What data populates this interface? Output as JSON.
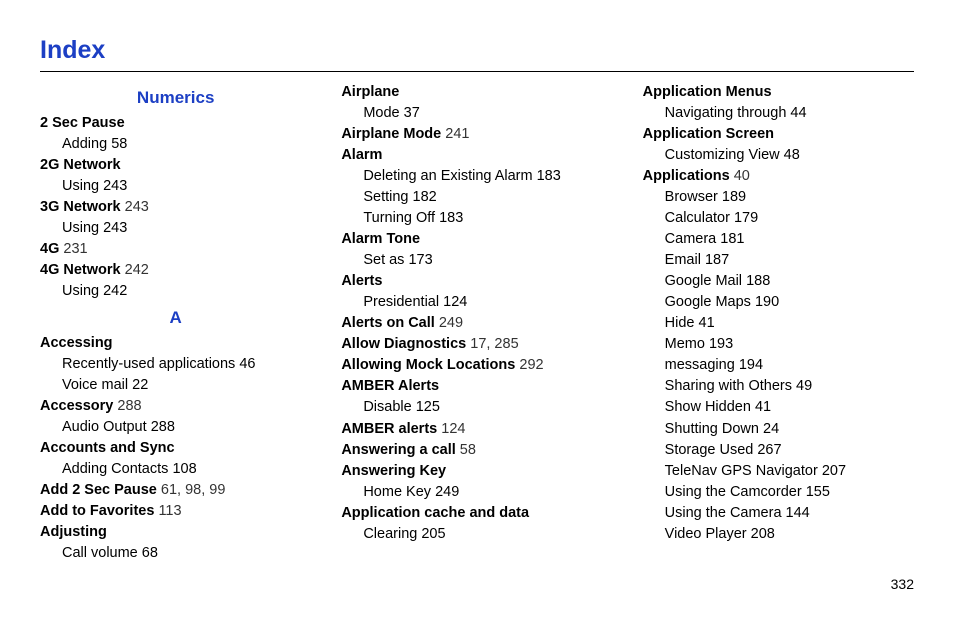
{
  "page_title": "Index",
  "page_number": "332",
  "columns": [
    {
      "sections": [
        {
          "heading": "Numerics",
          "entries": [
            {
              "term": "2 Sec Pause",
              "subs": [
                {
                  "label": "Adding",
                  "page": "58"
                }
              ]
            },
            {
              "term": "2G Network",
              "subs": [
                {
                  "label": "Using",
                  "page": "243"
                }
              ]
            },
            {
              "term": "3G Network",
              "page": "243",
              "subs": [
                {
                  "label": "Using",
                  "page": "243"
                }
              ]
            },
            {
              "term": "4G",
              "page": "231"
            },
            {
              "term": "4G Network",
              "page": "242",
              "subs": [
                {
                  "label": "Using",
                  "page": "242"
                }
              ]
            }
          ]
        },
        {
          "heading": "A",
          "entries": [
            {
              "term": "Accessing",
              "subs": [
                {
                  "label": "Recently-used applications",
                  "page": "46"
                },
                {
                  "label": "Voice mail",
                  "page": "22"
                }
              ]
            },
            {
              "term": "Accessory",
              "page": "288",
              "subs": [
                {
                  "label": "Audio Output",
                  "page": "288"
                }
              ]
            },
            {
              "term": "Accounts and Sync",
              "subs": [
                {
                  "label": "Adding Contacts",
                  "page": "108"
                }
              ]
            },
            {
              "term": "Add 2 Sec Pause",
              "page": "61, 98, 99"
            },
            {
              "term": "Add to Favorites",
              "page": "113"
            },
            {
              "term": "Adjusting",
              "subs": [
                {
                  "label": "Call volume",
                  "page": "68"
                }
              ]
            }
          ]
        }
      ]
    },
    {
      "sections": [
        {
          "heading": null,
          "entries": [
            {
              "term": "Airplane",
              "subs": [
                {
                  "label": "Mode",
                  "page": "37"
                }
              ]
            },
            {
              "term": "Airplane Mode",
              "page": "241"
            },
            {
              "term": "Alarm",
              "subs": [
                {
                  "label": "Deleting an Existing Alarm",
                  "page": "183"
                },
                {
                  "label": "Setting",
                  "page": "182"
                },
                {
                  "label": "Turning Off",
                  "page": "183"
                }
              ]
            },
            {
              "term": "Alarm Tone",
              "subs": [
                {
                  "label": "Set as",
                  "page": "173"
                }
              ]
            },
            {
              "term": "Alerts",
              "subs": [
                {
                  "label": "Presidential",
                  "page": "124"
                }
              ]
            },
            {
              "term": "Alerts on Call",
              "page": "249"
            },
            {
              "term": "Allow Diagnostics",
              "page": "17, 285"
            },
            {
              "term": "Allowing Mock Locations",
              "page": "292"
            },
            {
              "term": "AMBER Alerts",
              "subs": [
                {
                  "label": "Disable",
                  "page": "125"
                }
              ]
            },
            {
              "term": "AMBER alerts",
              "page": "124"
            },
            {
              "term": "Answering a call",
              "page": "58"
            },
            {
              "term": "Answering Key",
              "subs": [
                {
                  "label": "Home Key",
                  "page": "249"
                }
              ]
            },
            {
              "term": "Application cache and data",
              "subs": [
                {
                  "label": "Clearing",
                  "page": "205"
                }
              ]
            }
          ]
        }
      ]
    },
    {
      "sections": [
        {
          "heading": null,
          "entries": [
            {
              "term": "Application Menus",
              "subs": [
                {
                  "label": "Navigating through",
                  "page": "44"
                }
              ]
            },
            {
              "term": "Application Screen",
              "subs": [
                {
                  "label": "Customizing View",
                  "page": "48"
                }
              ]
            },
            {
              "term": "Applications",
              "page": "40",
              "subs": [
                {
                  "label": "Browser",
                  "page": "189"
                },
                {
                  "label": "Calculator",
                  "page": "179"
                },
                {
                  "label": "Camera",
                  "page": "181"
                },
                {
                  "label": "Email",
                  "page": "187"
                },
                {
                  "label": "Google Mail",
                  "page": "188"
                },
                {
                  "label": "Google Maps",
                  "page": "190"
                },
                {
                  "label": "Hide",
                  "page": "41"
                },
                {
                  "label": "Memo",
                  "page": "193"
                },
                {
                  "label": "messaging",
                  "page": "194"
                },
                {
                  "label": "Sharing with Others",
                  "page": "49"
                },
                {
                  "label": "Show Hidden",
                  "page": "41"
                },
                {
                  "label": "Shutting Down",
                  "page": "24"
                },
                {
                  "label": "Storage Used",
                  "page": "267"
                },
                {
                  "label": "TeleNav GPS Navigator",
                  "page": "207"
                },
                {
                  "label": "Using the Camcorder",
                  "page": "155"
                },
                {
                  "label": "Using the Camera",
                  "page": "144"
                },
                {
                  "label": "Video Player",
                  "page": "208"
                }
              ]
            }
          ]
        }
      ]
    }
  ]
}
